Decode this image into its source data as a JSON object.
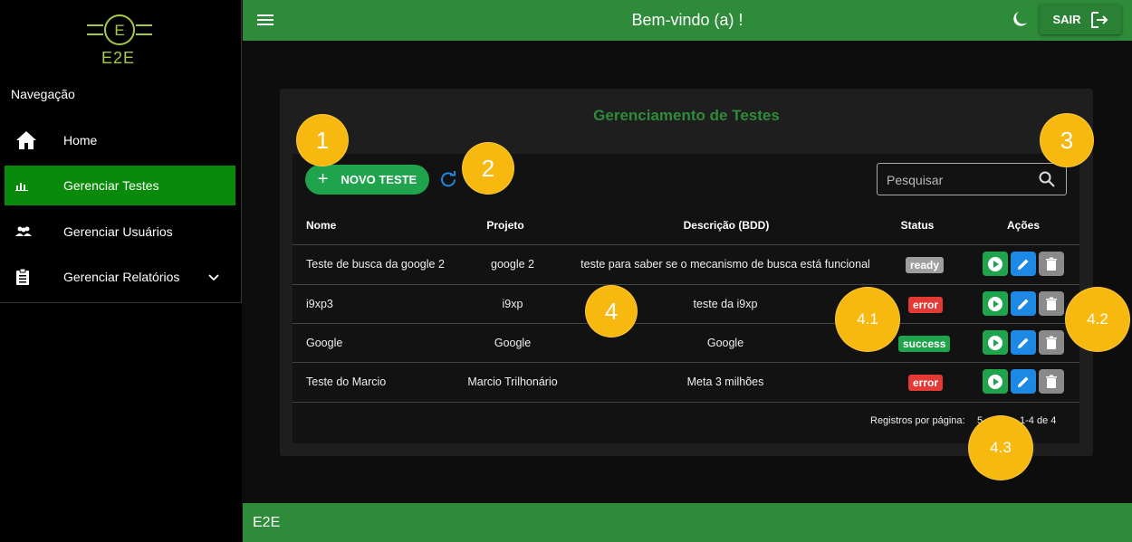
{
  "app": {
    "logo_letter": "E",
    "logo_text": "E2E",
    "header_title": "Bem-vindo (a) !",
    "logout_label": "SAIR",
    "footer_text": "E2E"
  },
  "sidebar": {
    "title": "Navegação",
    "items": [
      {
        "label": "Home",
        "icon": "home-icon"
      },
      {
        "label": "Gerenciar Testes",
        "icon": "chart-icon",
        "active": true
      },
      {
        "label": "Gerenciar Usuários",
        "icon": "users-icon"
      },
      {
        "label": "Gerenciar Relatórios",
        "icon": "clipboard-icon",
        "has_submenu": true
      }
    ]
  },
  "page": {
    "title": "Gerenciamento de Testes",
    "new_button": "NOVO TESTE",
    "search_placeholder": "Pesquisar"
  },
  "table": {
    "columns": [
      "Nome",
      "Projeto",
      "Descrição (BDD)",
      "Status",
      "Ações"
    ],
    "rows": [
      {
        "nome": "Teste de busca da google 2",
        "projeto": "google 2",
        "descricao": "teste para saber se o mecanismo de busca está funcional",
        "status": "ready"
      },
      {
        "nome": "i9xp3",
        "projeto": "i9xp",
        "descricao": "teste da i9xp",
        "status": "error"
      },
      {
        "nome": "Google",
        "projeto": "Google",
        "descricao": "Google",
        "status": "success"
      },
      {
        "nome": "Teste do Marcio",
        "projeto": "Marcio Trilhonário",
        "descricao": "Meta 3 milhões",
        "status": "error"
      }
    ]
  },
  "pagination": {
    "label": "Registros por página:",
    "page_size": "5",
    "range": "1-4 de 4"
  },
  "callouts": [
    "1",
    "2",
    "3",
    "4",
    "4.1",
    "4.2",
    "4.3"
  ],
  "colors": {
    "brand_green": "#2e8b3a",
    "active_nav": "#0a8a0a",
    "ready": "#9e9e9e",
    "error": "#e53935",
    "success": "#1fa34d",
    "callout": "#f7b90f"
  }
}
